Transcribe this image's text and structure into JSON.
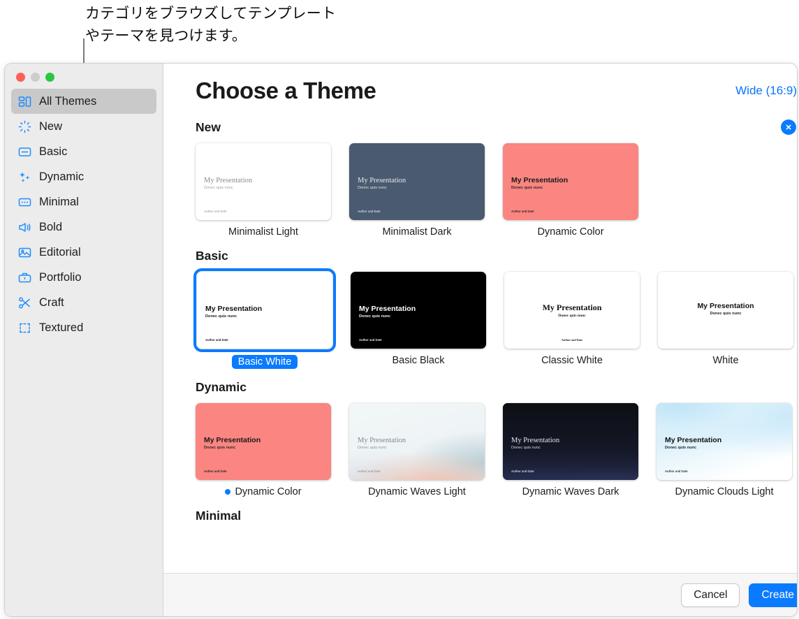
{
  "callout": {
    "text": "カテゴリをブラウズしてテンプレート\nやテーマを見つけます。"
  },
  "colors": {
    "accent": "#0a7bff",
    "sidebar_bg": "#ececec",
    "selected_row": "#c9c9c9"
  },
  "window": {
    "traffic_lights": [
      "close-red",
      "minimize-gray",
      "zoom-green"
    ]
  },
  "sidebar": {
    "items": [
      {
        "label": "All Themes",
        "icon": "all-themes-icon",
        "selected": true
      },
      {
        "label": "New",
        "icon": "sparkle-burst-icon",
        "selected": false
      },
      {
        "label": "Basic",
        "icon": "basic-slide-icon",
        "selected": false
      },
      {
        "label": "Dynamic",
        "icon": "sparkles-icon",
        "selected": false
      },
      {
        "label": "Minimal",
        "icon": "minimal-dots-icon",
        "selected": false
      },
      {
        "label": "Bold",
        "icon": "megaphone-icon",
        "selected": false
      },
      {
        "label": "Editorial",
        "icon": "photo-icon",
        "selected": false
      },
      {
        "label": "Portfolio",
        "icon": "briefcase-icon",
        "selected": false
      },
      {
        "label": "Craft",
        "icon": "scissors-icon",
        "selected": false
      },
      {
        "label": "Textured",
        "icon": "crop-frame-icon",
        "selected": false
      }
    ]
  },
  "header": {
    "title": "Choose a Theme",
    "ratio_label": "Wide (16:9)"
  },
  "thumb_text": {
    "title": "My Presentation",
    "subtitle": "Donec quis nunc",
    "author": "Author and Date"
  },
  "sections": [
    {
      "name": "New",
      "has_close": true,
      "themes": [
        {
          "label": "Minimalist Light",
          "selected": false,
          "dot": false
        },
        {
          "label": "Minimalist Dark",
          "selected": false,
          "dot": false
        },
        {
          "label": "Dynamic Color",
          "selected": false,
          "dot": false
        }
      ]
    },
    {
      "name": "Basic",
      "has_close": false,
      "themes": [
        {
          "label": "Basic White",
          "selected": true,
          "dot": false
        },
        {
          "label": "Basic Black",
          "selected": false,
          "dot": false
        },
        {
          "label": "Classic White",
          "selected": false,
          "dot": false
        },
        {
          "label": "White",
          "selected": false,
          "dot": false
        }
      ]
    },
    {
      "name": "Dynamic",
      "has_close": false,
      "themes": [
        {
          "label": "Dynamic Color",
          "selected": false,
          "dot": true
        },
        {
          "label": "Dynamic Waves Light",
          "selected": false,
          "dot": false
        },
        {
          "label": "Dynamic Waves Dark",
          "selected": false,
          "dot": false
        },
        {
          "label": "Dynamic Clouds Light",
          "selected": false,
          "dot": false
        }
      ]
    },
    {
      "name": "Minimal",
      "has_close": false,
      "themes": []
    }
  ],
  "footer": {
    "cancel_label": "Cancel",
    "create_label": "Create"
  }
}
